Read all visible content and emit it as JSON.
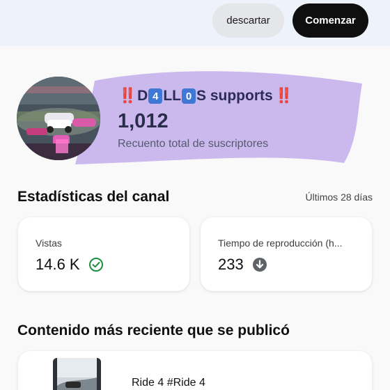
{
  "topbar": {
    "discard_label": "descartar",
    "start_label": "Comenzar"
  },
  "channel": {
    "name_prefix_emoji": "‼️",
    "name_part1": "D",
    "name_key1": "4",
    "name_part2": "LL",
    "name_key2": "0",
    "name_part3": "S supports",
    "name_suffix_emoji": "‼️",
    "subscriber_count": "1,012",
    "subscriber_label": "Recuento total de suscriptores",
    "banner_color": "#cbb9ee"
  },
  "stats": {
    "title": "Estadísticas del canal",
    "period": "Últimos 28 días",
    "views_label": "Vistas",
    "views_value": "14.6 K",
    "views_icon": "check-circle-icon",
    "watch_label": "Tiempo de reproducción (h...",
    "watch_value": "233",
    "watch_icon": "arrow-down-circle-icon"
  },
  "recent": {
    "title": "Contenido más reciente que se publicó",
    "video_title": "Ride 4 #Ride 4"
  },
  "colors": {
    "accent_green": "#1e8e3e",
    "down_gray": "#5f6368",
    "primary_button": "#0f0f0f"
  }
}
